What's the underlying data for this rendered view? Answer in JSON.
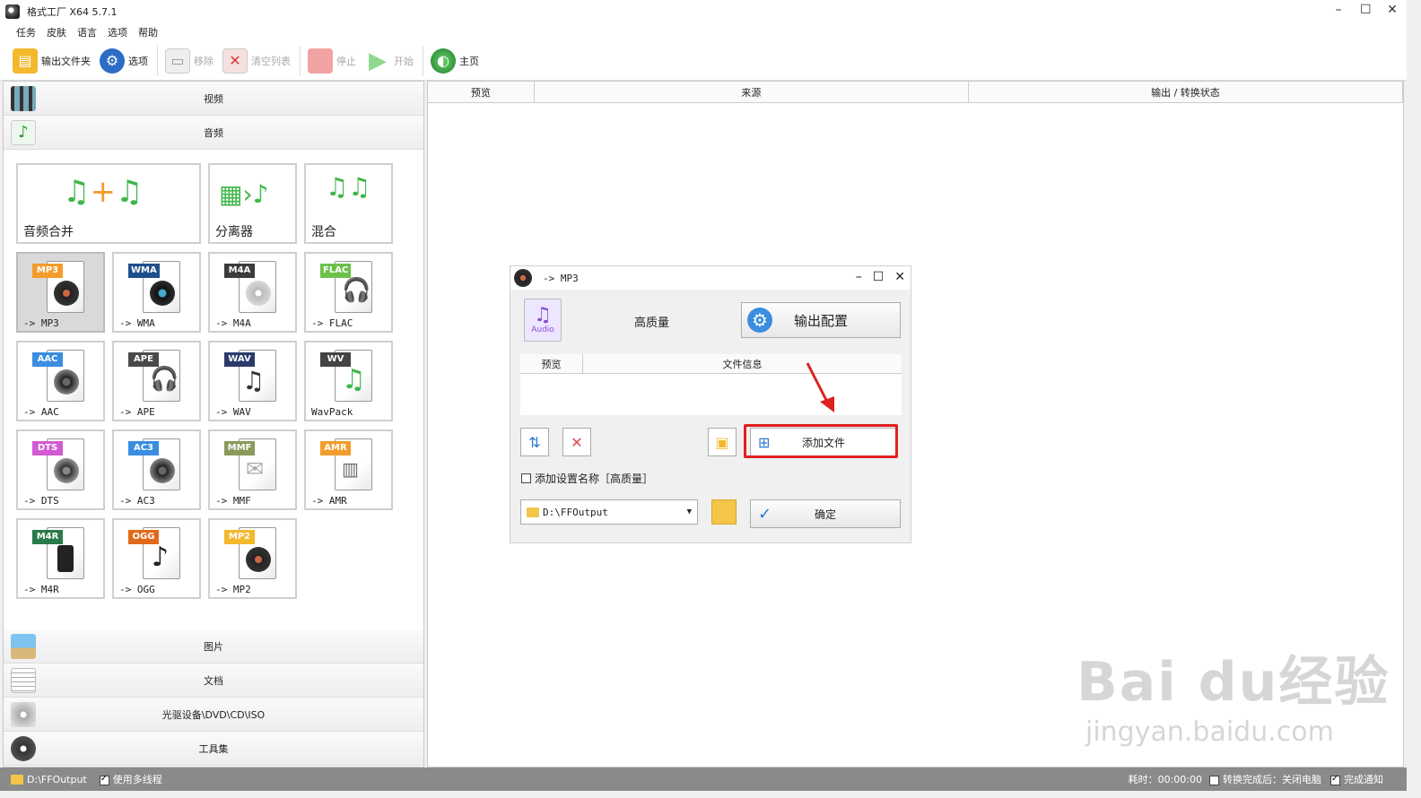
{
  "window": {
    "title": "格式工厂 X64 5.7.1"
  },
  "menu": [
    "任务",
    "皮肤",
    "语言",
    "选项",
    "帮助"
  ],
  "toolbar": {
    "output_folder": "输出文件夹",
    "options": "选项",
    "remove": "移除",
    "clear_list": "清空列表",
    "stop": "停止",
    "start": "开始",
    "home": "主页"
  },
  "categories": {
    "video": "视频",
    "audio": "音频",
    "image": "图片",
    "document": "文档",
    "disc": "光驱设备\\DVD\\CD\\ISO",
    "tools": "工具集"
  },
  "audio_tools": {
    "merge": "音频合并",
    "splitter": "分离器",
    "mix": "混合"
  },
  "formats": [
    {
      "badge": "MP3",
      "label": "-> MP3",
      "color": "#f39c2c",
      "selected": true
    },
    {
      "badge": "WMA",
      "label": "-> WMA",
      "color": "#1f4f8a"
    },
    {
      "badge": "M4A",
      "label": "-> M4A",
      "color": "#3c3c3c"
    },
    {
      "badge": "FLAC",
      "label": "-> FLAC",
      "color": "#6cc14a"
    },
    {
      "badge": "AAC",
      "label": "-> AAC",
      "color": "#3a8de0"
    },
    {
      "badge": "APE",
      "label": "-> APE",
      "color": "#4a4a4a"
    },
    {
      "badge": "WAV",
      "label": "-> WAV",
      "color": "#2a3a6a"
    },
    {
      "badge": "WV",
      "label": "WavPack",
      "color": "#444444"
    },
    {
      "badge": "DTS",
      "label": "-> DTS",
      "color": "#d25ad2"
    },
    {
      "badge": "AC3",
      "label": "-> AC3",
      "color": "#3a8de0"
    },
    {
      "badge": "MMF",
      "label": "-> MMF",
      "color": "#8a9a5a"
    },
    {
      "badge": "AMR",
      "label": "-> AMR",
      "color": "#f39c2c"
    },
    {
      "badge": "M4R",
      "label": "-> M4R",
      "color": "#2a7a4a"
    },
    {
      "badge": "OGG",
      "label": "-> OGG",
      "color": "#e06a1a"
    },
    {
      "badge": "MP2",
      "label": "-> MP2",
      "color": "#f3b82c"
    }
  ],
  "list_header": {
    "preview": "预览",
    "source": "来源",
    "status": "输出 / 转换状态"
  },
  "status_bar": {
    "path": "D:\\FFOutput",
    "multithread": "使用多线程",
    "elapsed": "耗时：00:00:00",
    "after_convert": "转换完成后：关闭电脑",
    "notify": "完成通知"
  },
  "dialog": {
    "title": "-> MP3",
    "audio_icon_label": "Audio",
    "quality": "高质量",
    "output_config": "输出配置",
    "col_preview": "预览",
    "col_fileinfo": "文件信息",
    "add_file": "添加文件",
    "add_setting_name": "添加设置名称［高质量］",
    "output_path": "D:\\FFOutput",
    "ok": "确定"
  },
  "watermark": {
    "line1": "Bai du经验",
    "line2": "jingyan.baidu.com"
  },
  "colors": {
    "highlight": "#e02020",
    "status_bar": "#8a8a8a",
    "gear": "#3a8de0"
  }
}
